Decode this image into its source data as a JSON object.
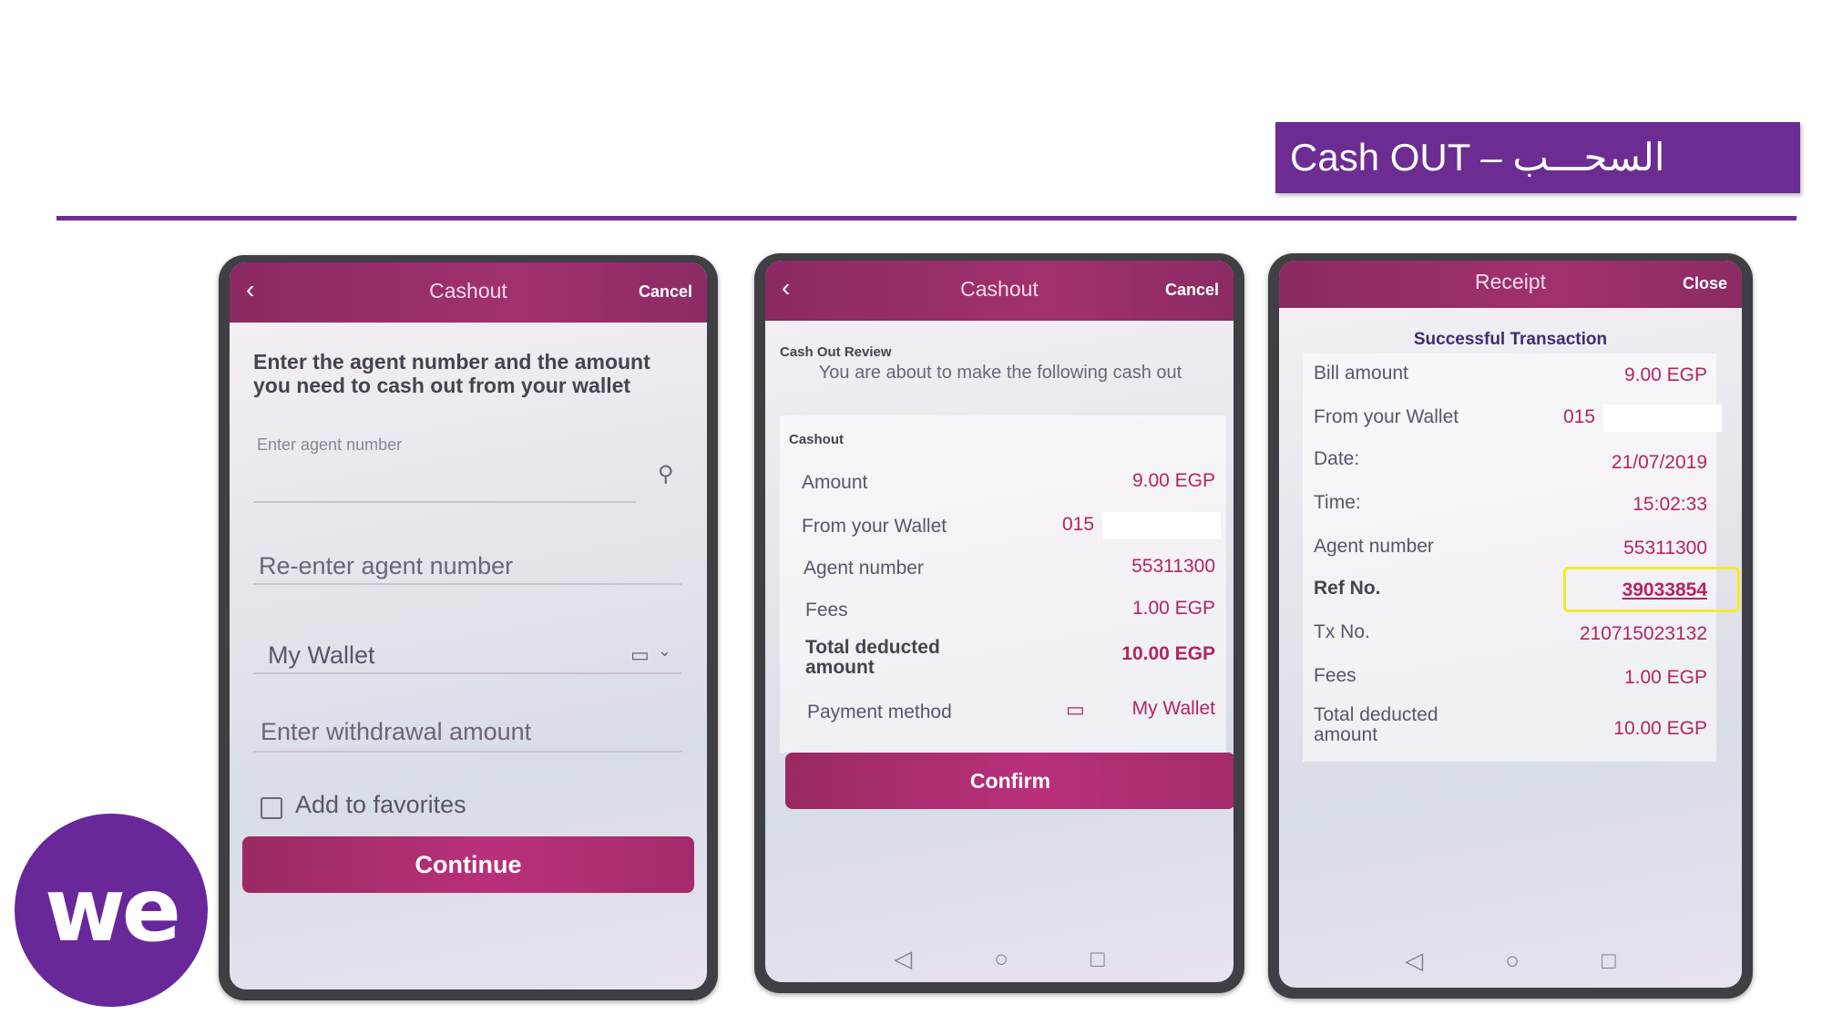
{
  "slide": {
    "title": "Cash OUT – السحـــب",
    "logo_text": "we",
    "accent_color": "#6c2c91"
  },
  "phone1": {
    "appbar": {
      "back_icon": "chevron-left-icon",
      "title": "Cashout",
      "cancel": "Cancel"
    },
    "instruction": "Enter the agent number and the amount you need to cash out from your wallet",
    "agent_number_placeholder": "Enter agent number",
    "reenter_placeholder": "Re-enter agent number",
    "wallet_select": "My Wallet",
    "amount_placeholder": "Enter withdrawal amount",
    "favorites_label": "Add to favorites",
    "continue": "Continue"
  },
  "phone2": {
    "appbar": {
      "back_icon": "chevron-left-icon",
      "title": "Cashout",
      "cancel": "Cancel"
    },
    "section_title": "Cash Out Review",
    "intro": "You are about to make the following cash out",
    "group_title": "Cashout",
    "rows": [
      {
        "label": "Amount",
        "value": "9.00 EGP"
      },
      {
        "label": "From your Wallet",
        "value": "015"
      },
      {
        "label": "Agent number",
        "value": "55311300"
      },
      {
        "label": "Fees",
        "value": "1.00 EGP"
      },
      {
        "label": "Total deducted amount",
        "value": "10.00 EGP"
      },
      {
        "label": "Payment method",
        "value": "My Wallet"
      }
    ],
    "confirm": "Confirm"
  },
  "phone3": {
    "appbar": {
      "title": "Receipt",
      "close": "Close"
    },
    "status": "Successful Transaction",
    "rows": [
      {
        "label": "Bill amount",
        "value": "9.00 EGP"
      },
      {
        "label": "From your Wallet",
        "value": "015"
      },
      {
        "label": "Date:",
        "value": "21/07/2019"
      },
      {
        "label": "Time:",
        "value": "15:02:33"
      },
      {
        "label": "Agent number",
        "value": "55311300"
      },
      {
        "label": "Ref No.",
        "value": "39033854"
      },
      {
        "label": "Tx No.",
        "value": "210715023132"
      },
      {
        "label": "Fees",
        "value": "1.00 EGP"
      },
      {
        "label": "Total deducted amount",
        "value": "10.00 EGP"
      }
    ]
  }
}
